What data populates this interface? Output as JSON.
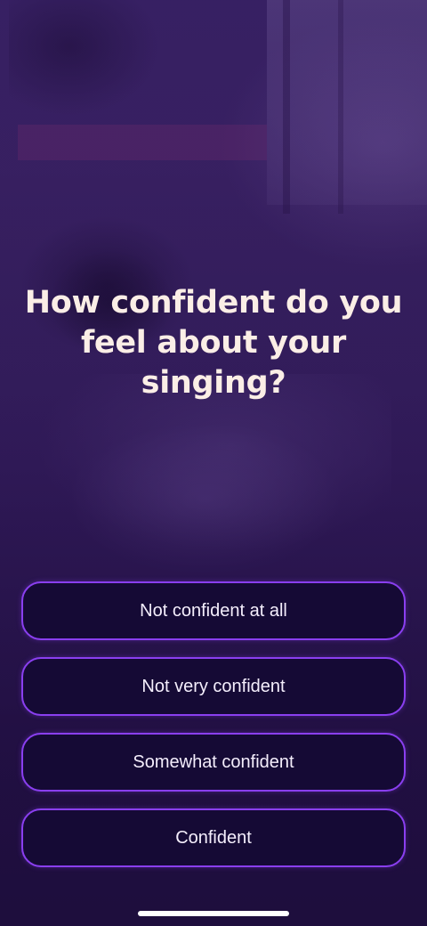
{
  "question": {
    "title": "How confident do you feel about your singing?"
  },
  "options": [
    {
      "label": "Not confident at all"
    },
    {
      "label": "Not very confident"
    },
    {
      "label": "Somewhat confident"
    },
    {
      "label": "Confident"
    }
  ],
  "colors": {
    "accent": "#8a3ff0",
    "button_fill": "#150a35",
    "title_text": "#fbeee6",
    "button_text": "#f4eefc"
  }
}
